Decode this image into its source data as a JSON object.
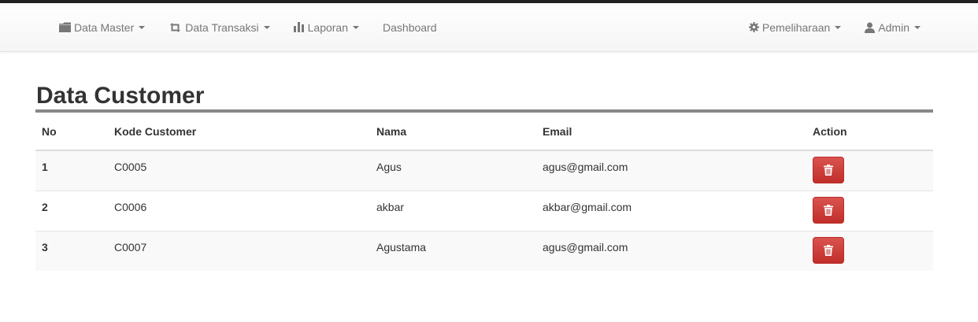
{
  "nav": {
    "left": [
      {
        "label": "Data Master",
        "icon": "folder-icon"
      },
      {
        "label": "Data Transaksi",
        "icon": "retweet-icon"
      },
      {
        "label": "Laporan",
        "icon": "bar-chart-icon"
      },
      {
        "label": "Dashboard"
      }
    ],
    "right": [
      {
        "label": "Pemeliharaan",
        "icon": "gear-icon"
      },
      {
        "label": "Admin",
        "icon": "user-icon"
      }
    ]
  },
  "page": {
    "title": "Data Customer"
  },
  "table": {
    "headers": [
      "No",
      "Kode Customer",
      "Nama",
      "Email",
      "Action"
    ],
    "rows": [
      {
        "no": "1",
        "kode": "C0005",
        "nama": "Agus",
        "email": "agus@gmail.com"
      },
      {
        "no": "2",
        "kode": "C0006",
        "nama": "akbar",
        "email": "akbar@gmail.com"
      },
      {
        "no": "3",
        "kode": "C0007",
        "nama": "Agustama",
        "email": "agus@gmail.com"
      }
    ]
  },
  "colors": {
    "danger": "#d9534f",
    "nav_text": "#777777",
    "title_rule": "#888888"
  }
}
